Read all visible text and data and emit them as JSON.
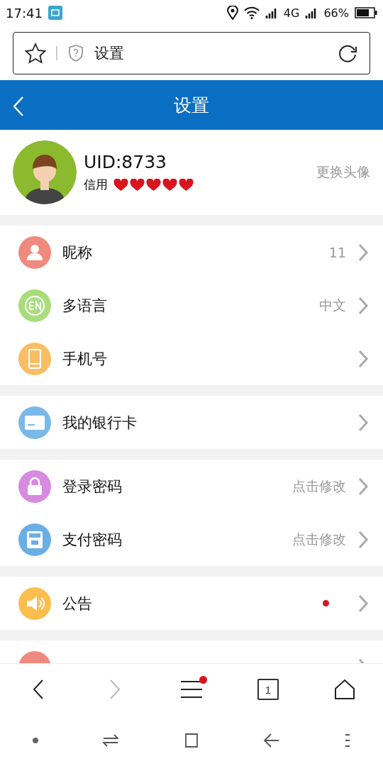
{
  "status_bar": {
    "time": "17:41",
    "network": "4G",
    "battery": "66%"
  },
  "address_bar": {
    "title": "设置"
  },
  "header": {
    "title": "设置"
  },
  "profile": {
    "uid": "UID:8733",
    "credit_label": "信用",
    "stars": 5,
    "action": "更换头像"
  },
  "groups": [
    {
      "items": [
        {
          "label": "昵称",
          "value": "11",
          "color": "#f08a7e",
          "new": false
        },
        {
          "label": "多语言",
          "value": "中文",
          "color": "#a8dd7c",
          "new": false
        },
        {
          "label": "手机号",
          "color": "#f9be63",
          "new": false
        }
      ]
    },
    {
      "items": [
        {
          "label": "我的银行卡",
          "color": "#7ab8ea",
          "new": false
        }
      ]
    },
    {
      "items": [
        {
          "label": "登录密码",
          "value": "点击修改",
          "color": "#d88ae0",
          "new": false
        },
        {
          "label": "支付密码",
          "value": "点击修改",
          "color": "#6aaee6",
          "new": false
        }
      ]
    },
    {
      "items": [
        {
          "label": "公告",
          "color": "#fbbd4e",
          "new": true
        }
      ]
    },
    {
      "items": [
        {
          "color": "#f08a7e",
          "new": false
        }
      ]
    }
  ],
  "browser_toolbar": {
    "forward_disabled": true,
    "menu_new": true,
    "tab_count": "1"
  }
}
